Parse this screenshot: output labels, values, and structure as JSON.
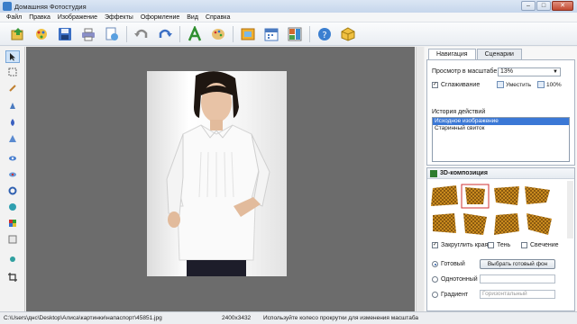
{
  "window": {
    "title": "Домашняя Фотостудия",
    "controls": {
      "minimize": "–",
      "maximize": "□",
      "close": "✕"
    }
  },
  "menu": {
    "items": [
      "Файл",
      "Правка",
      "Изображение",
      "Эффекты",
      "Оформление",
      "Вид",
      "Справка"
    ]
  },
  "toolbar": {
    "icons": [
      "open-icon",
      "gallery-icon",
      "save-icon",
      "print-icon",
      "export-icon",
      "undo-icon",
      "redo-icon",
      "text-icon",
      "palette-icon",
      "frame-icon",
      "calendar-icon",
      "collage-icon",
      "help-icon",
      "cube-icon"
    ]
  },
  "tools": {
    "icons": [
      "cursor-icon",
      "select-icon",
      "crop-icon",
      "pen-icon",
      "drop-icon",
      "triangle-icon",
      "eye-icon",
      "redeye-icon",
      "ring-icon",
      "clone-icon",
      "color-icon",
      "transform-icon",
      "crop-frame-icon"
    ]
  },
  "panel": {
    "tabs": [
      "Навигация",
      "Сценарии"
    ],
    "zoom_label": "Просмотр в масштабе",
    "zoom_value": "13%",
    "smoothing_label": "Сглаживание",
    "fit_label": "Уместить",
    "actual_size_label": "100%",
    "history_label": "История действий",
    "history_items": [
      "Исходное изображение",
      "Старинный свиток"
    ]
  },
  "composition": {
    "title": "3D-композиция",
    "options": {
      "round_edges": "Закруглить края",
      "shadow": "Тень",
      "glow": "Свечение"
    },
    "background": {
      "ready_label": "Готовый",
      "choose_button": "Выбрать готовый фон",
      "solid_label": "Однотонный",
      "gradient_label": "Градиент",
      "gradient_value": "Горизонтальный"
    }
  },
  "status": {
    "path": "C:\\Users\\днс\\Desktop\\Алиса\\картинки\\напаспорт\\45851.jpg",
    "dimensions": "2400x3432",
    "hint": "Используйте колесо прокрутки для изменения масштаба"
  },
  "colors": {
    "canvas": "#6c6c6c",
    "selection": "#3b78d6",
    "accent": "#d03030"
  }
}
